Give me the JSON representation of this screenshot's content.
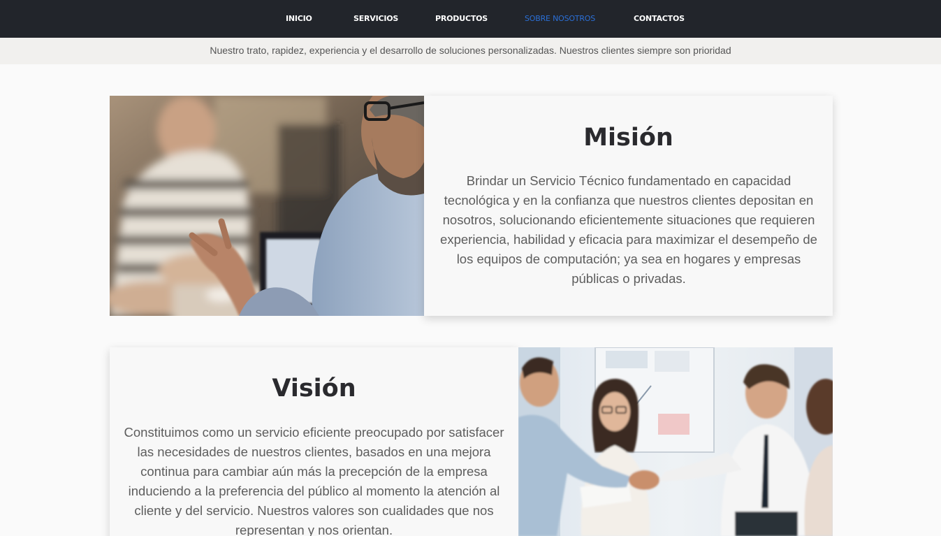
{
  "nav": {
    "items": [
      {
        "label": "INICIO"
      },
      {
        "label": "SERVICIOS"
      },
      {
        "label": "PRODUCTOS"
      },
      {
        "label": "SOBRE NOSOTROS"
      },
      {
        "label": "CONTACTOS"
      }
    ],
    "active_index": 3
  },
  "tagline": "Nuestro trato, rapidez, experiencia y el desarrollo de soluciones personalizadas. Nuestros clientes siempre son prioridad",
  "mission": {
    "title": "Misión",
    "text": "Brindar un Servicio Técnico fundamentado en capacidad tecnológica y en la confianza que nuestros clientes depositan en nosotros, solucionando eficientemente situaciones que requieren experiencia, habilidad y eficacia para maximizar el desempeño de los equipos de computación; ya sea en hogares y empresas públicas o privadas."
  },
  "vision": {
    "title": "Visión",
    "text": "Constituimos como un servicio eficiente preocupado por satisfacer las necesidades de nuestros clientes, basados en una mejora continua para cambiar aún más la precepción de la empresa induciendo a la preferencia del público al momento la atención al cliente y del servicio. Nuestros valores son cualidades que nos representan y nos orientan."
  },
  "colors": {
    "nav_bg": "#22252b",
    "nav_active": "#2b6fd6",
    "tagline_bg": "#f1f0ee"
  }
}
